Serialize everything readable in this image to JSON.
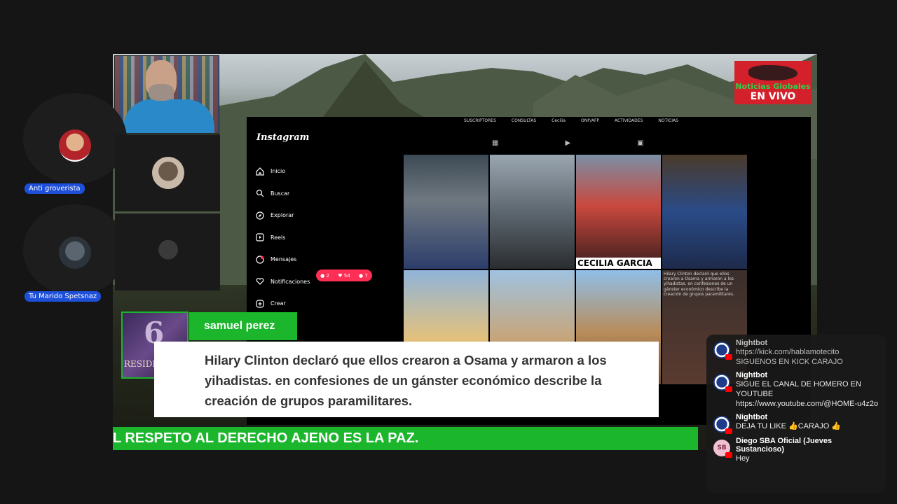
{
  "stream": {
    "channel_logo": {
      "line1": "Noticias Globales",
      "line2": "EN VIVO"
    },
    "instagram": {
      "brand": "Instagram",
      "top_nav": [
        "SUSCRIPTORES",
        "CONSULTAS",
        "Cecilia",
        "ONP/AFP",
        "ACTIVIDADES",
        "NOTICIAS"
      ],
      "nav_items": [
        {
          "label": "Inicio",
          "icon": "home-icon"
        },
        {
          "label": "Buscar",
          "icon": "search-icon"
        },
        {
          "label": "Explorar",
          "icon": "compass-icon"
        },
        {
          "label": "Reels",
          "icon": "reels-icon"
        },
        {
          "label": "Mensajes",
          "icon": "messenger-icon"
        },
        {
          "label": "Notificaciones",
          "icon": "heart-icon"
        },
        {
          "label": "Crear",
          "icon": "plus-square-icon"
        }
      ],
      "notification_counts": {
        "comments": "2",
        "likes": "54",
        "followers": "7"
      },
      "tile_caption": "CECILIA GARCIA",
      "post_overlay_text": "Hilary Clinton declaró que ellos crearon a Osama y armaron a los yihadistas. en confesiones de un gánster económico describe la creación de grupos paramilitares."
    },
    "participants": [
      {
        "name": "Anti groverista"
      },
      {
        "name": "Tu Marido Spetsnaz"
      }
    ],
    "featured_comment": {
      "thumbnail_text": "RESIDENT E",
      "author": "samuel perez",
      "text": "Hilary Clinton declaró que ellos crearon a Osama y armaron a los yihadistas. en confesiones de un gánster económico describe la creación de grupos paramilitares."
    },
    "ticker": "L RESPETO AL DERECHO AJENO ES LA PAZ."
  },
  "chat": {
    "messages": [
      {
        "author": "Nightbot",
        "lines": [
          "https://kick.com/hablamotecito",
          "SIGUENOS EN KICK CARAJO"
        ],
        "faded": true
      },
      {
        "author": "Nightbot",
        "lines": [
          "SIGUE EL CANAL DE HOMERO EN YOUTUBE",
          "https://www.youtube.com/@HOME-u4z2o"
        ],
        "faded": false
      },
      {
        "author": "Nightbot",
        "lines": [
          "DEJA TU LIKE 👍CARAJO 👍"
        ],
        "faded": false
      },
      {
        "author": "Diego SBA Oficial (Jueves Sustancioso)",
        "lines": [
          "Hey"
        ],
        "faded": false
      }
    ]
  }
}
